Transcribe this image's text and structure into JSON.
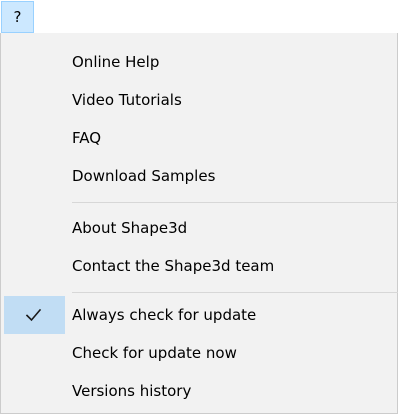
{
  "menubar": {
    "help_menu_label": "?"
  },
  "menu": {
    "groups": [
      {
        "items": [
          {
            "label": "Online Help"
          },
          {
            "label": "Video Tutorials"
          },
          {
            "label": "FAQ"
          },
          {
            "label": "Download Samples"
          }
        ]
      },
      {
        "items": [
          {
            "label": "About Shape3d"
          },
          {
            "label": "Contact the Shape3d team"
          }
        ]
      },
      {
        "items": [
          {
            "label": "Always check for update",
            "checked": true,
            "icon": "check-icon"
          },
          {
            "label": "Check for update now"
          },
          {
            "label": "Versions history"
          }
        ]
      }
    ]
  },
  "colors": {
    "menubar_highlight": "#cce8ff",
    "menu_background": "#f2f2f2",
    "check_highlight": "#90c8f6",
    "separator": "#d7d7d7"
  }
}
